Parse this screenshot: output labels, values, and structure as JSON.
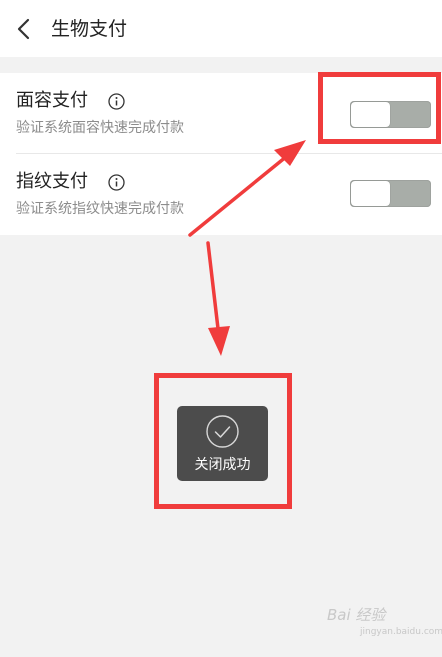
{
  "header": {
    "title": "生物支付",
    "back_icon": "chevron-left-icon"
  },
  "settings": [
    {
      "title": "面容支付",
      "subtitle": "验证系统面容快速完成付款",
      "info_icon": "info-circle-icon",
      "enabled": false
    },
    {
      "title": "指纹支付",
      "subtitle": "验证系统指纹快速完成付款",
      "info_icon": "info-circle-icon",
      "enabled": false
    }
  ],
  "toast": {
    "icon": "check-circle-icon",
    "text": "关闭成功"
  },
  "watermark": {
    "text": "Bai 经验",
    "sub": "jingyan.baidu.com"
  },
  "colors": {
    "annotation": "#f03c3c",
    "toggle_track": "#a8ada8",
    "toast_bg": "#4c4c4c",
    "page_bg": "#f2f2f2"
  }
}
